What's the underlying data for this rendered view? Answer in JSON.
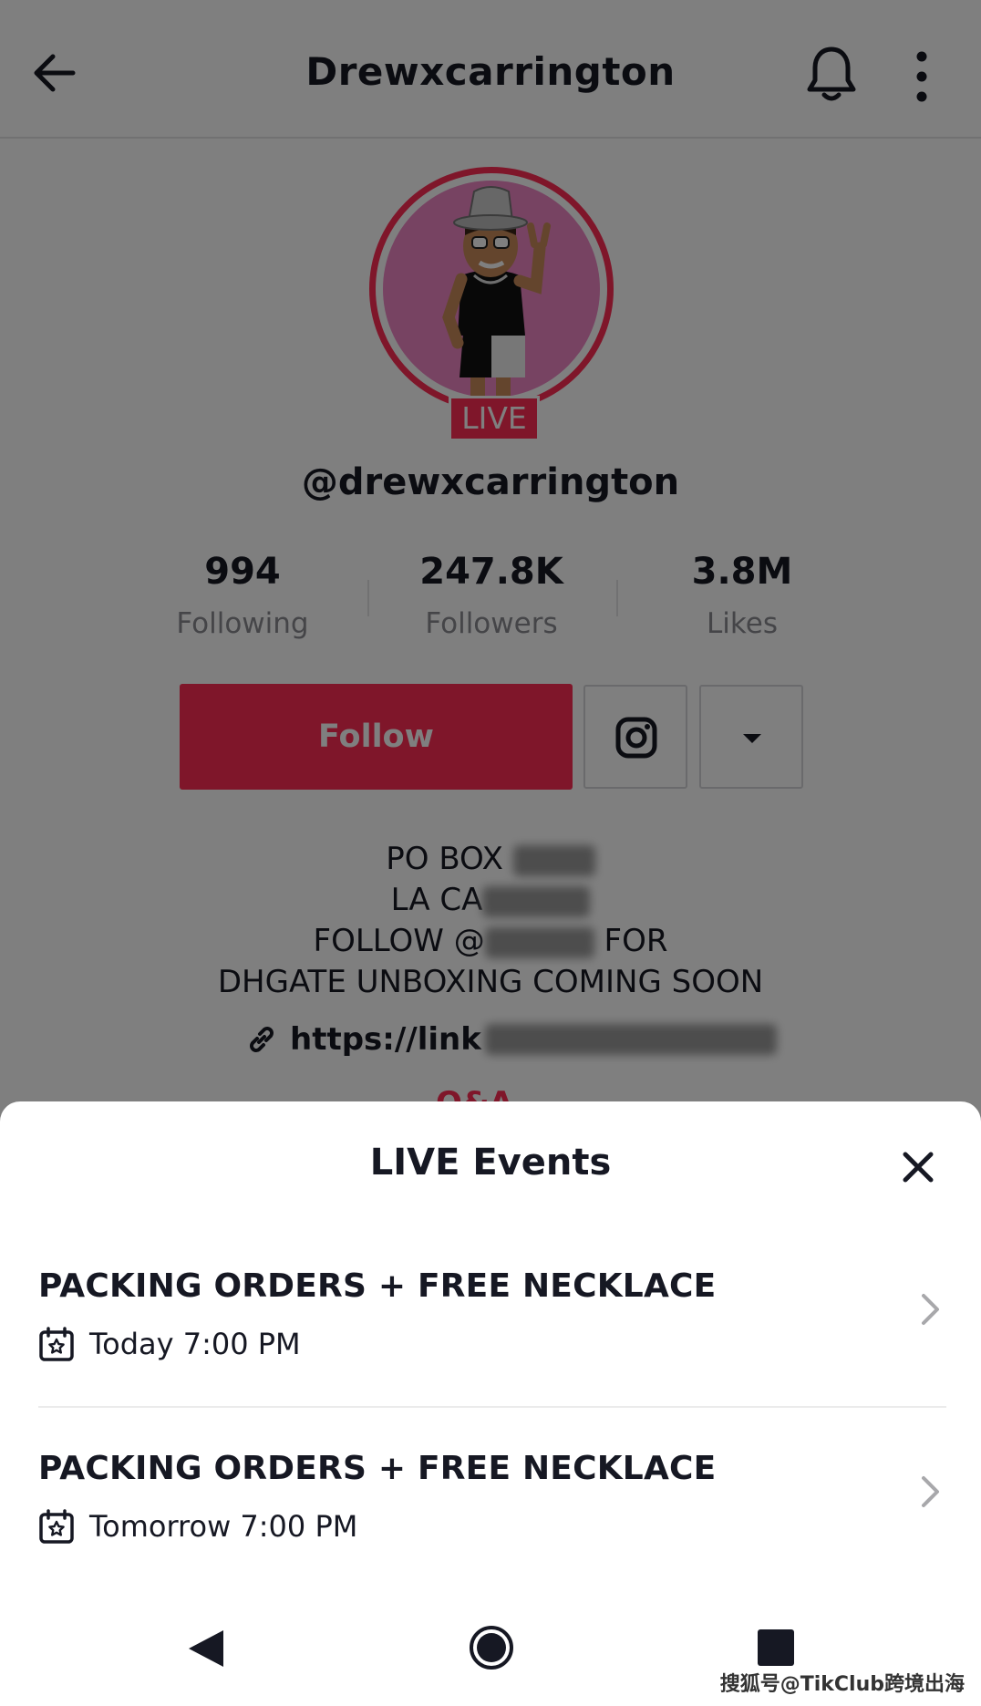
{
  "header": {
    "title": "Drewxcarrington"
  },
  "profile": {
    "live_badge": "LIVE",
    "handle": "@drewxcarrington",
    "stats": [
      {
        "value": "994",
        "label": "Following"
      },
      {
        "value": "247.8K",
        "label": "Followers"
      },
      {
        "value": "3.8M",
        "label": "Likes"
      }
    ],
    "follow_label": "Follow",
    "bio": {
      "line1_prefix": "PO BOX",
      "line2_prefix": "LA CA",
      "line3_prefix": "FOLLOW @",
      "line3_suffix": "FOR",
      "line4": "DHGATE UNBOXING COMING SOON"
    },
    "link_prefix": "https://link",
    "qa_label": "Q&A"
  },
  "sheet": {
    "title": "LIVE Events",
    "events": [
      {
        "title": "PACKING ORDERS + FREE NECKLACE",
        "time": "Today 7:00 PM"
      },
      {
        "title": "PACKING ORDERS + FREE NECKLACE",
        "time": "Tomorrow 7:00 PM"
      }
    ]
  },
  "watermark": "搜狐号@TikClub跨境出海",
  "colors": {
    "accent": "#fe2c55",
    "text": "#161823",
    "muted": "#8a8b91"
  }
}
